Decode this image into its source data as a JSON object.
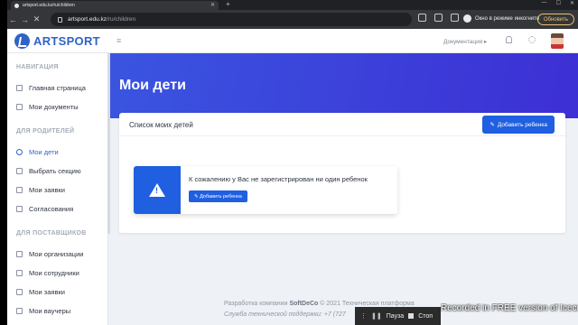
{
  "browser": {
    "tab_title": "artsport.edu.kz/ru/children",
    "tab_close": "✕",
    "new_tab": "+",
    "url_host": "artsport.edu.kz",
    "url_path": "/ru/children",
    "incognito_label": "Окно в режиме инкогнито",
    "update_label": "Обновить"
  },
  "header": {
    "logo_text": "ARTSPORT",
    "menu_glyph": "≡",
    "docs_label": "Документация ▸"
  },
  "sidebar": {
    "sections": [
      {
        "title": "НАВИГАЦИЯ",
        "items": [
          "Главная страница",
          "Мои документы"
        ]
      },
      {
        "title": "ДЛЯ РОДИТЕЛЕЙ",
        "items": [
          "Мои дети",
          "Выбрать секцию",
          "Мои заявки",
          "Согласования"
        ]
      },
      {
        "title": "ДЛЯ ПОСТАВЩИКОВ",
        "items": [
          "Мои организации",
          "Мои сотрудники",
          "Мои заявки",
          "Мои ваучеры"
        ]
      }
    ],
    "active_item": "Мои дети"
  },
  "main": {
    "page_title": "Мои дети",
    "card_title": "Список моих детей",
    "add_child_label": "Добавить ребенка",
    "alert_message": "К сожалению у Вас не зарегистрирован ни один ребенок",
    "alert_button_label": "Добавить ребенка"
  },
  "footer": {
    "line1_prefix": "Разработка компании",
    "line1_company": "SoftDeCo",
    "line1_suffix": "© 2021 Техническая платформа",
    "line2": "Служба технической поддержки: +7 (727"
  },
  "recorder": {
    "pause_label": "Пауза",
    "stop_label": "Стоп",
    "watermark": "Recorded in FREE version of Icecream  Screen  Recorder"
  },
  "colors": {
    "primary": "#1f5fe0",
    "brand": "#2f63c8",
    "hero_start": "#3a55e0",
    "hero_end": "#3d2fd4"
  }
}
